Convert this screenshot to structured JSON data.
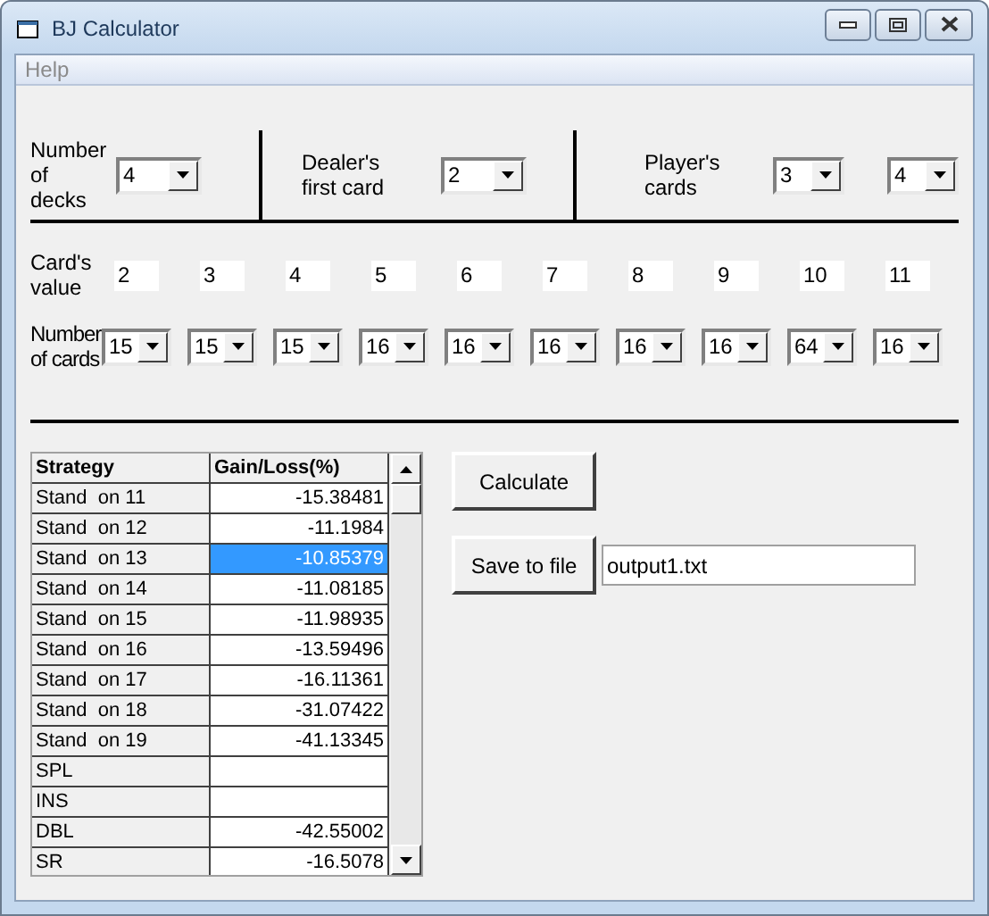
{
  "window": {
    "title": "BJ Calculator"
  },
  "menu": [
    "Help"
  ],
  "decks": {
    "label": "Number of decks",
    "value": "4"
  },
  "dealer": {
    "label": "Dealer's first card",
    "value": "2"
  },
  "player": {
    "label": "Player's cards",
    "values": [
      "3",
      "4"
    ]
  },
  "card_values": {
    "label": "Card's value",
    "values": [
      "2",
      "3",
      "4",
      "5",
      "6",
      "7",
      "8",
      "9",
      "10",
      "11"
    ]
  },
  "card_counts": {
    "label": "Number of cards",
    "values": [
      "15",
      "15",
      "15",
      "16",
      "16",
      "16",
      "16",
      "16",
      "64",
      "16"
    ]
  },
  "table": {
    "columns": [
      "Strategy",
      "Gain/Loss(%)"
    ],
    "rows": [
      {
        "strategy": "Stand  on 11",
        "value": "-15.38481",
        "selected": false
      },
      {
        "strategy": "Stand  on 12",
        "value": "-11.1984",
        "selected": false
      },
      {
        "strategy": "Stand  on 13",
        "value": "-10.85379",
        "selected": true
      },
      {
        "strategy": "Stand  on 14",
        "value": "-11.08185",
        "selected": false
      },
      {
        "strategy": "Stand  on 15",
        "value": "-11.98935",
        "selected": false
      },
      {
        "strategy": "Stand  on 16",
        "value": "-13.59496",
        "selected": false
      },
      {
        "strategy": "Stand  on 17",
        "value": "-16.11361",
        "selected": false
      },
      {
        "strategy": "Stand  on 18",
        "value": "-31.07422",
        "selected": false
      },
      {
        "strategy": "Stand  on 19",
        "value": "-41.13345",
        "selected": false
      },
      {
        "strategy": "SPL",
        "value": "",
        "selected": false
      },
      {
        "strategy": "INS",
        "value": "",
        "selected": false
      },
      {
        "strategy": "DBL",
        "value": "-42.55002",
        "selected": false
      },
      {
        "strategy": "SR",
        "value": "-16.5078",
        "selected": false
      }
    ]
  },
  "calculate_button": "Calculate",
  "save_button": "Save to file",
  "file_field": {
    "value": "output1.txt"
  }
}
